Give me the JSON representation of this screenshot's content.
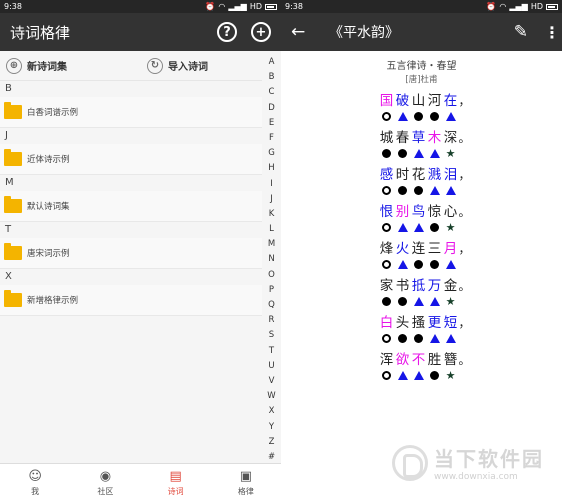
{
  "left": {
    "status": {
      "time": "9:38",
      "net": "HD"
    },
    "appbar": {
      "title": "诗词格律",
      "help_glyph": "?",
      "add_glyph": "+"
    },
    "actions": [
      {
        "icon": "add-collection-icon",
        "label": "新诗词集"
      },
      {
        "icon": "import-icon",
        "label": "导入诗词"
      }
    ],
    "sections": [
      {
        "letter": "B",
        "items": [
          "白香词谱示例"
        ]
      },
      {
        "letter": "J",
        "items": [
          "近体诗示例"
        ]
      },
      {
        "letter": "M",
        "items": [
          "默认诗词集"
        ]
      },
      {
        "letter": "T",
        "items": [
          "唐宋词示例"
        ]
      },
      {
        "letter": "X",
        "items": [
          "新增格律示例"
        ]
      }
    ],
    "index_letters": [
      "A",
      "B",
      "C",
      "D",
      "E",
      "F",
      "G",
      "H",
      "I",
      "J",
      "K",
      "L",
      "M",
      "N",
      "O",
      "P",
      "Q",
      "R",
      "S",
      "T",
      "U",
      "V",
      "W",
      "X",
      "Y",
      "Z",
      "#"
    ],
    "nav": [
      {
        "icon": "person-icon",
        "label": "我",
        "active": false
      },
      {
        "icon": "community-icon",
        "label": "社区",
        "active": false
      },
      {
        "icon": "poetry-icon",
        "label": "诗词",
        "active": true
      },
      {
        "icon": "rules-icon",
        "label": "格律",
        "active": false
      }
    ]
  },
  "right": {
    "status": {
      "time": "9:38",
      "net": "HD"
    },
    "appbar": {
      "back_glyph": "←",
      "title": "《平水韵》",
      "edit_glyph": "✎",
      "more_glyph": "⋮"
    },
    "poem_title": "五言律诗・春望",
    "poem_author": "[唐]杜甫",
    "colors": {
      "blue": "#1515e6",
      "pink": "#e815e8",
      "star": "#17402a"
    },
    "lines": [
      {
        "chars": [
          [
            "国",
            "p"
          ],
          [
            "破",
            "b"
          ],
          [
            "山",
            "n"
          ],
          [
            "河",
            "n"
          ],
          [
            "在",
            "b"
          ]
        ],
        "punct": "，",
        "marks": [
          "ring",
          "tri",
          "dot",
          "dot",
          "tri"
        ]
      },
      {
        "chars": [
          [
            "城",
            "n"
          ],
          [
            "春",
            "n"
          ],
          [
            "草",
            "b"
          ],
          [
            "木",
            "p"
          ],
          [
            "深",
            "n"
          ]
        ],
        "punct": "。",
        "marks": [
          "dot",
          "dot",
          "tri",
          "tri",
          "star"
        ]
      },
      {
        "chars": [
          [
            "感",
            "b"
          ],
          [
            "时",
            "n"
          ],
          [
            "花",
            "n"
          ],
          [
            "溅",
            "b"
          ],
          [
            "泪",
            "b"
          ]
        ],
        "punct": "，",
        "marks": [
          "ring",
          "dot",
          "dot",
          "tri",
          "tri"
        ]
      },
      {
        "chars": [
          [
            "恨",
            "b"
          ],
          [
            "别",
            "p"
          ],
          [
            "鸟",
            "b"
          ],
          [
            "惊",
            "n"
          ],
          [
            "心",
            "n"
          ]
        ],
        "punct": "。",
        "marks": [
          "ring",
          "tri",
          "tri",
          "dot",
          "star"
        ]
      },
      {
        "chars": [
          [
            "烽",
            "n"
          ],
          [
            "火",
            "b"
          ],
          [
            "连",
            "n"
          ],
          [
            "三",
            "n"
          ],
          [
            "月",
            "p"
          ]
        ],
        "punct": "，",
        "marks": [
          "ring",
          "tri",
          "dot",
          "dot",
          "tri"
        ]
      },
      {
        "chars": [
          [
            "家",
            "n"
          ],
          [
            "书",
            "n"
          ],
          [
            "抵",
            "b"
          ],
          [
            "万",
            "b"
          ],
          [
            "金",
            "n"
          ]
        ],
        "punct": "。",
        "marks": [
          "dot",
          "dot",
          "tri",
          "tri",
          "star"
        ]
      },
      {
        "chars": [
          [
            "白",
            "p"
          ],
          [
            "头",
            "n"
          ],
          [
            "搔",
            "n"
          ],
          [
            "更",
            "b"
          ],
          [
            "短",
            "b"
          ]
        ],
        "punct": "，",
        "marks": [
          "ring",
          "dot",
          "dot",
          "tri",
          "tri"
        ]
      },
      {
        "chars": [
          [
            "浑",
            "n"
          ],
          [
            "欲",
            "p"
          ],
          [
            "不",
            "p"
          ],
          [
            "胜",
            "n"
          ],
          [
            "簪",
            "n"
          ]
        ],
        "punct": "。",
        "marks": [
          "ring",
          "tri",
          "tri",
          "dot",
          "star"
        ]
      }
    ],
    "watermark": {
      "cn": "当下软件园",
      "url": "www.downxia.com"
    }
  }
}
